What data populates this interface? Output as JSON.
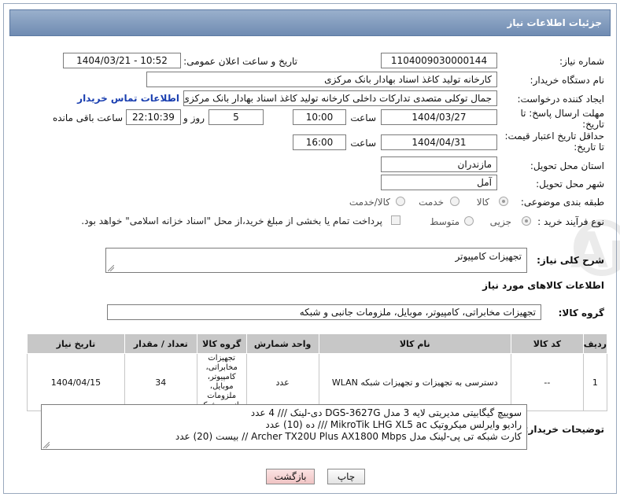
{
  "header": {
    "title": "جزئیات اطلاعات نیاز"
  },
  "fields": {
    "need_number_label": "شماره نیاز:",
    "need_number": "1104009030000144",
    "announce_label": "تاریخ و ساعت اعلان عمومی:",
    "announce_value": "1404/03/21 - 10:52",
    "buyer_org_label": "نام دستگاه خریدار:",
    "buyer_org": "کارخانه تولید کاغذ اسناد بهادار بانک مرکزی",
    "creator_label": "ایجاد کننده درخواست:",
    "creator": "جمال توکلی  متصدی تدارکات داخلی کارخانه تولید کاغذ اسناد بهادار بانک مرکزی",
    "contact_link": "اطلاعات تماس خریدار",
    "reply_deadline_label": "مهلت ارسال پاسخ: تا تاریخ:",
    "reply_date": "1404/03/27",
    "time_label": "ساعت",
    "reply_time": "10:00",
    "days_value": "5",
    "days_label": "روز و",
    "remaining_time": "22:10:39",
    "remaining_label": "ساعت باقی مانده",
    "price_deadline_label": "حداقل تاریخ اعتبار قیمت: تا تاریخ:",
    "price_date": "1404/04/31",
    "time_label2": "ساعت",
    "price_time": "16:00",
    "province_label": "استان محل تحویل:",
    "province": "مازندران",
    "city_label": "شهر محل تحویل:",
    "city": "آمل",
    "category_label": "طبقه بندی موضوعی:",
    "cat_goods": "کالا",
    "cat_service": "خدمت",
    "cat_both": "کالا/خدمت",
    "process_label": "نوع فرآیند خرید :",
    "proc_partial": "جزیی",
    "proc_medium": "متوسط",
    "payment_note": "پرداخت تمام یا بخشی از مبلغ خرید،از محل \"اسناد خزانه اسلامی\" خواهد بود."
  },
  "summary": {
    "label": "شرح کلی نیاز:",
    "value": "تجهیزات کامپیوتر"
  },
  "goods_section": {
    "title": "اطلاعات کالاهای مورد نیاز",
    "group_label": "گروه کالا:",
    "group_value": "تجهیزات مخابراتی، کامپیوتر، موبایل، ملزومات جانبی و شبکه"
  },
  "table": {
    "headers": [
      "ردیف",
      "کد کالا",
      "نام کالا",
      "واحد شمارش",
      "گروه کالا",
      "تعداد / مقدار",
      "تاریخ نیاز"
    ],
    "rows": [
      [
        "1",
        "--",
        "دسترسی به تجهیزات و تجهیزات شبکه WLAN",
        "عدد",
        "تجهیزات مخابراتی، کامپیوتر، موبایل، ملزومات جانبی و شبکه",
        "34",
        "1404/04/15"
      ]
    ]
  },
  "buyer_notes": {
    "label": "توضیحات خریدار:",
    "lines": [
      "سوییچ گیگابیتی مدیریتی لایه 3 مدل DGS-3627G دی-لینک ///  4 عدد",
      "رادیو وایرلس میکروتیک MikroTik LHG XL5 ac  ///  ده (10) عدد",
      "کارت شبکه تی پی-لینک مدل Archer TX20U Plus AX1800 Mbps // بیست (20) عدد"
    ]
  },
  "buttons": {
    "print": "چاپ",
    "back": "بازگشت"
  },
  "watermark": {
    "text": "AriaTender.neT"
  },
  "colors": {
    "titlebar": "#7f98bc",
    "link": "#1a3fb0",
    "back_button": "#f6d3d3"
  }
}
